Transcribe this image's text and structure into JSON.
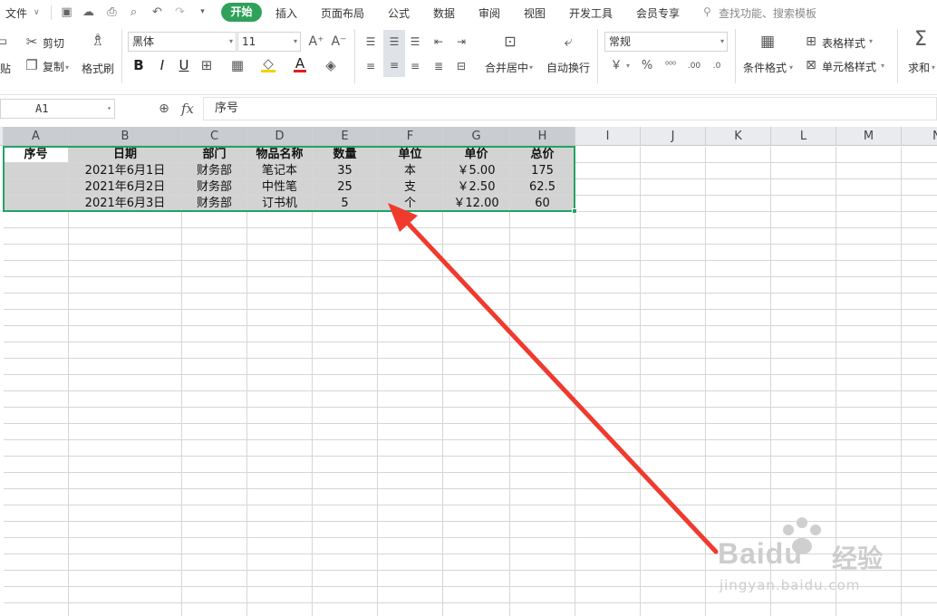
{
  "menu": {
    "file": "文件",
    "tabs": [
      "开始",
      "插入",
      "页面布局",
      "公式",
      "数据",
      "审阅",
      "视图",
      "开发工具",
      "会员专享"
    ],
    "search": "查找功能、搜索模板"
  },
  "ribbon": {
    "paste": "贴",
    "cut": "剪切",
    "copy": "复制",
    "format_painter": "格式刷",
    "font_name": "黑体",
    "font_size": "11",
    "merge_center": "合并居中",
    "wrap_text": "自动换行",
    "number_format": "常规",
    "conditional_format": "条件格式",
    "table_style": "表格样式",
    "cell_style": "单元格样式",
    "sum": "求和",
    "bold": "B",
    "italic": "I",
    "underline": "U"
  },
  "formula_bar": {
    "name_box": "A1",
    "fx": "fx",
    "content": "序号"
  },
  "columns": [
    "A",
    "B",
    "C",
    "D",
    "E",
    "F",
    "G",
    "H",
    "I",
    "J",
    "K",
    "L",
    "M",
    "N"
  ],
  "table": {
    "headers": [
      "序号",
      "日期",
      "部门",
      "物品名称",
      "数量",
      "单位",
      "单价",
      "总价"
    ],
    "rows": [
      [
        "",
        "2021年6月1日",
        "财务部",
        "笔记本",
        "35",
        "本",
        "￥5.00",
        "175"
      ],
      [
        "",
        "2021年6月2日",
        "财务部",
        "中性笔",
        "25",
        "支",
        "￥2.50",
        "62.5"
      ],
      [
        "",
        "2021年6月3日",
        "财务部",
        "订书机",
        "5",
        "个",
        "￥12.00",
        "60"
      ]
    ]
  },
  "watermark": {
    "brand": "Baidu",
    "suffix": "经验",
    "url": "jingyan.baidu.com"
  },
  "colors": {
    "accent_green": "#2fa15a",
    "selection_border": "#21a366",
    "arrow": "#f03a2e"
  }
}
